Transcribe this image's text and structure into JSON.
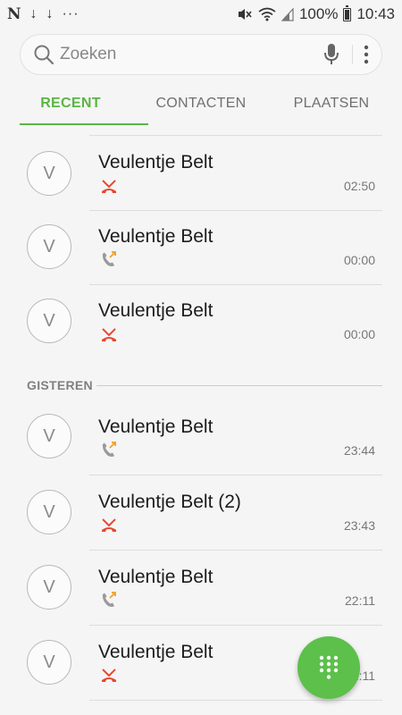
{
  "status_bar": {
    "left_icons": [
      "N",
      "↓",
      "↓",
      "···"
    ],
    "battery_percent": "100%",
    "time": "10:43"
  },
  "search": {
    "placeholder": "Zoeken"
  },
  "tabs": [
    {
      "label": "RECENT",
      "active": true
    },
    {
      "label": "CONTACTEN",
      "active": false
    },
    {
      "label": "PLAATSEN",
      "active": false
    }
  ],
  "sections": [
    {
      "header": "",
      "calls": [
        {
          "initial": "V",
          "name": "Veulentje Belt",
          "type": "missed",
          "time": "02:50"
        },
        {
          "initial": "V",
          "name": "Veulentje Belt",
          "type": "outgoing",
          "time": "00:00"
        },
        {
          "initial": "V",
          "name": "Veulentje Belt",
          "type": "missed",
          "time": "00:00"
        }
      ]
    },
    {
      "header": "GISTEREN",
      "calls": [
        {
          "initial": "V",
          "name": "Veulentje Belt",
          "type": "outgoing",
          "time": "23:44"
        },
        {
          "initial": "V",
          "name": "Veulentje Belt (2)",
          "type": "missed",
          "time": "23:43"
        },
        {
          "initial": "V",
          "name": "Veulentje Belt",
          "type": "outgoing",
          "time": "22:11"
        },
        {
          "initial": "V",
          "name": "Veulentje Belt",
          "type": "missed",
          "time": "22:11"
        }
      ]
    }
  ],
  "colors": {
    "accent": "#5bb546",
    "missed": "#e8472f",
    "outgoing_arrow": "#f0a02a",
    "fab": "#5cc04a"
  },
  "fab": {
    "icon": "dialpad-icon"
  }
}
